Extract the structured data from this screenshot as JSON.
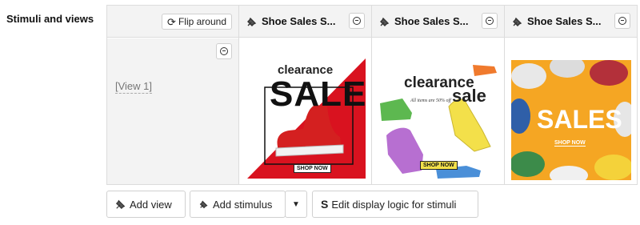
{
  "section": {
    "label": "Stimuli and views"
  },
  "header": {
    "flip_label": "Flip around"
  },
  "stimuli": [
    {
      "title": "Shoe Sales S..."
    },
    {
      "title": "Shoe Sales S..."
    },
    {
      "title": "Shoe Sales S..."
    }
  ],
  "views": [
    {
      "label": "[View 1]"
    }
  ],
  "images": {
    "img1": {
      "top": "clearance",
      "big": "SALES",
      "cta": "SHOP NOW"
    },
    "img2": {
      "top": "clearance",
      "big": "sale",
      "sub": "All items are 50% off",
      "cta": "SHOP NOW"
    },
    "img3": {
      "big": "SALES",
      "cta": "SHOP NOW"
    }
  },
  "actions": {
    "add_view": "Add view",
    "add_stimulus": "Add stimulus",
    "edit_logic": "Edit display logic for stimuli"
  },
  "colors": {
    "red": "#d9121f",
    "yellow_shoe": "#f3e04a",
    "orange_bg": "#f5a623",
    "grid_border": "#dcdcdc"
  }
}
